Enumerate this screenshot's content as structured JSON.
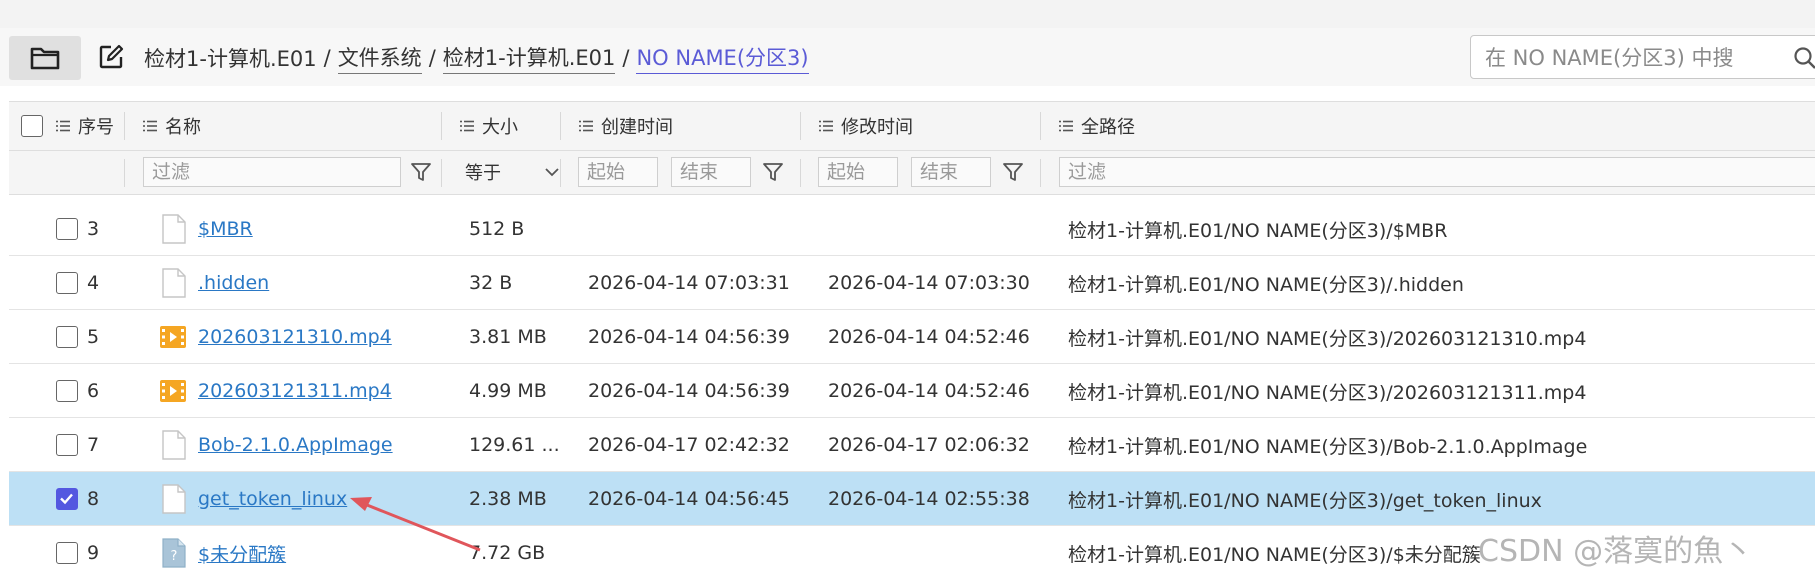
{
  "breadcrumb": {
    "items": [
      "检材1-计算机.E01",
      "文件系统",
      "检材1-计算机.E01",
      "NO NAME(分区3)"
    ],
    "separator": "/"
  },
  "search": {
    "placeholder": "在 NO NAME(分区3) 中搜"
  },
  "columns": {
    "index": "序号",
    "name": "名称",
    "size": "大小",
    "created": "创建时间",
    "modified": "修改时间",
    "path": "全路径"
  },
  "filters": {
    "name_placeholder": "过滤",
    "size_op": "等于",
    "created_start": "起始",
    "created_end": "结束",
    "modified_start": "起始",
    "modified_end": "结束",
    "path_placeholder": "过滤"
  },
  "rows": [
    {
      "index": "3",
      "name": "$MBR",
      "icon": "file-icon",
      "size": "512 B",
      "created": "",
      "modified": "",
      "path": "检材1-计算机.E01/NO NAME(分区3)/$MBR",
      "checked": false
    },
    {
      "index": "4",
      "name": ".hidden",
      "icon": "file-icon",
      "size": "32 B",
      "created": "2026-04-14 07:03:31",
      "modified": "2026-04-14 07:03:30",
      "path": "检材1-计算机.E01/NO NAME(分区3)/.hidden",
      "checked": false
    },
    {
      "index": "5",
      "name": "202603121310.mp4",
      "icon": "video-icon",
      "size": "3.81 MB",
      "created": "2026-04-14 04:56:39",
      "modified": "2026-04-14 04:52:46",
      "path": "检材1-计算机.E01/NO NAME(分区3)/202603121310.mp4",
      "checked": false
    },
    {
      "index": "6",
      "name": "202603121311.mp4",
      "icon": "video-icon",
      "size": "4.99 MB",
      "created": "2026-04-14 04:56:39",
      "modified": "2026-04-14 04:52:46",
      "path": "检材1-计算机.E01/NO NAME(分区3)/202603121311.mp4",
      "checked": false
    },
    {
      "index": "7",
      "name": "Bob-2.1.0.AppImage",
      "icon": "file-icon",
      "size": "129.61 ...",
      "created": "2026-04-17 02:42:32",
      "modified": "2026-04-17 02:06:32",
      "path": "检材1-计算机.E01/NO NAME(分区3)/Bob-2.1.0.AppImage",
      "checked": false
    },
    {
      "index": "8",
      "name": "get_token_linux",
      "icon": "file-icon",
      "size": "2.38 MB",
      "created": "2026-04-14 04:56:45",
      "modified": "2026-04-14 02:55:38",
      "path": "检材1-计算机.E01/NO NAME(分区3)/get_token_linux",
      "checked": true
    },
    {
      "index": "9",
      "name": "$未分配簇",
      "icon": "unknown-file-icon",
      "size": "7.72 GB",
      "created": "",
      "modified": "",
      "path": "检材1-计算机.E01/NO NAME(分区3)/$未分配簇",
      "checked": false
    }
  ],
  "watermark": "CSDN @落寞的魚丶",
  "colors": {
    "accent": "#5458e0",
    "link": "#2a78c5",
    "selected_row": "#bde0f5",
    "annotation_arrow": "#e0565b",
    "video_icon": "#f5a623"
  }
}
